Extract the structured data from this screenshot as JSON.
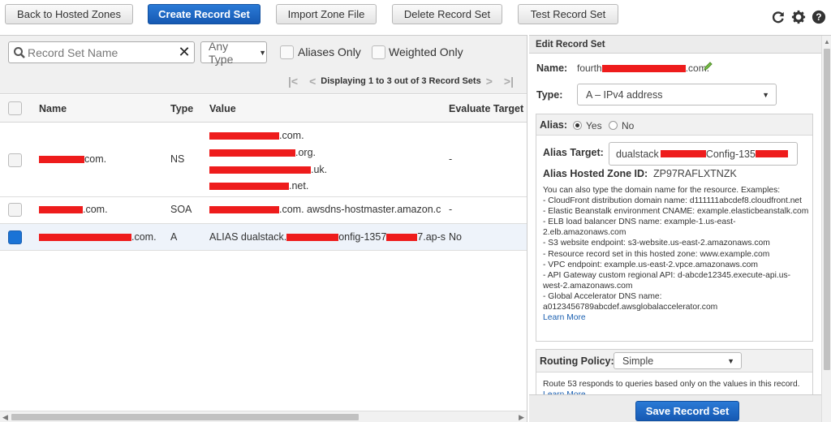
{
  "toolbar": {
    "back": "Back to Hosted Zones",
    "create": "Create Record Set",
    "import": "Import Zone File",
    "delete": "Delete Record Set",
    "test": "Test Record Set"
  },
  "top_icons": [
    "refresh-icon",
    "gear-icon",
    "help-icon"
  ],
  "filters": {
    "search_placeholder": "Record Set Name",
    "clear": "✕",
    "type": "Any Type",
    "aliases_only": "Aliases Only",
    "weighted_only": "Weighted Only",
    "pager_text": "Displaying 1 to 3 out of 3 Record Sets"
  },
  "table": {
    "headers": [
      "Name",
      "Type",
      "Value",
      "Evaluate Target"
    ],
    "rows": [
      {
        "name": "com.",
        "type": "NS",
        "values": [
          ".com.",
          ".org.",
          ".uk.",
          ".net."
        ],
        "evaluate": "-"
      },
      {
        "name": ".com.",
        "type": "SOA",
        "values": [
          ".com. awsdns-hostmaster.amazon.c"
        ],
        "evaluate": "-"
      },
      {
        "name": ".com.",
        "type": "A",
        "values": [
          "ALIAS dualstack.",
          "onfig-1357",
          "7.ap-s"
        ],
        "evaluate": "No"
      }
    ]
  },
  "edit": {
    "title": "Edit Record Set",
    "name_label": "Name:",
    "name_prefix": "fourth",
    "name_suffix": ".com.",
    "type_label": "Type:",
    "type_value": "A – IPv4 address",
    "alias_label": "Alias:",
    "alias_yes": "Yes",
    "alias_no": "No",
    "alias_target_label": "Alias Target:",
    "alias_target_prefix": "dualstack",
    "alias_target_mid": "Config-135",
    "hosted_zone_label": "Alias Hosted Zone ID:",
    "hosted_zone_value": "ZP97RAFLXTNZK",
    "help_lines": [
      "You can also type the domain name for the resource. Examples:",
      "- CloudFront distribution domain name: d111111abcdef8.cloudfront.net",
      "- Elastic Beanstalk environment CNAME: example.elasticbeanstalk.com",
      "- ELB load balancer DNS name: example-1.us-east-",
      "2.elb.amazonaws.com",
      "- S3 website endpoint: s3-website.us-east-2.amazonaws.com",
      "- Resource record set in this hosted zone: www.example.com",
      "- VPC endpoint: example.us-east-2.vpce.amazonaws.com",
      "- API Gateway custom regional API: d-abcde12345.execute-api.us-",
      "west-2.amazonaws.com",
      "- Global Accelerator DNS name:",
      "a0123456789abcdef.awsglobalaccelerator.com"
    ],
    "learn_more": "Learn More",
    "routing_label": "Routing Policy:",
    "routing_value": "Simple",
    "routing_help": "Route 53 responds to queries based only on the values in this record.",
    "routing_learn_more": "Learn More",
    "save": "Save Record Set"
  }
}
